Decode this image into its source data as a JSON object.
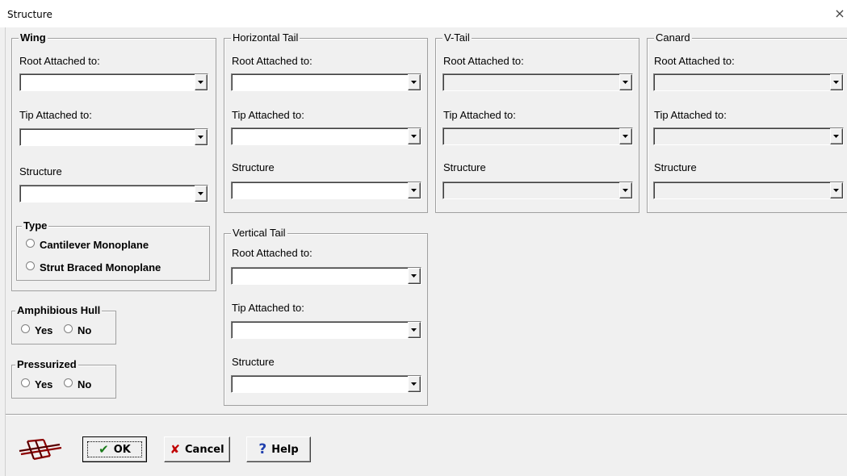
{
  "window": {
    "title": "Structure",
    "close_glyph": "×"
  },
  "wing": {
    "title": "Wing",
    "root_label": "Root Attached to:",
    "tip_label": "Tip Attached to:",
    "structure_label": "Structure",
    "root_value": "",
    "tip_value": "",
    "structure_value": "",
    "type": {
      "title": "Type",
      "options": [
        "Cantilever Monoplane",
        "Strut Braced Monoplane"
      ]
    }
  },
  "horizontal_tail": {
    "title": "Horizontal Tail",
    "root_label": "Root Attached to:",
    "tip_label": "Tip Attached to:",
    "structure_label": "Structure",
    "root_value": "",
    "tip_value": "",
    "structure_value": ""
  },
  "v_tail": {
    "title": "V-Tail",
    "root_label": "Root Attached to:",
    "tip_label": "Tip Attached to:",
    "structure_label": "Structure",
    "root_value": "",
    "tip_value": "",
    "structure_value": "",
    "enabled": false
  },
  "canard": {
    "title": "Canard",
    "root_label": "Root Attached to:",
    "tip_label": "Tip Attached to:",
    "structure_label": "Structure",
    "root_value": "",
    "tip_value": "",
    "structure_value": "",
    "enabled": false
  },
  "vertical_tail": {
    "title": "Vertical Tail",
    "root_label": "Root Attached to:",
    "tip_label": "Tip Attached to:",
    "structure_label": "Structure",
    "root_value": "",
    "tip_value": "",
    "structure_value": ""
  },
  "amphibious_hull": {
    "title": "Amphibious Hull",
    "yes": "Yes",
    "no": "No"
  },
  "pressurized": {
    "title": "Pressurized",
    "yes": "Yes",
    "no": "No"
  },
  "buttons": {
    "ok": "OK",
    "cancel": "Cancel",
    "help": "Help",
    "ok_icon": "checkmark-icon",
    "cancel_icon": "x-icon",
    "help_icon": "question-mark-icon"
  },
  "colors": {
    "ok_check": "#1a7a1a",
    "cancel_x": "#c00000",
    "help_q": "#1f3fae",
    "structure_icon": "#8b0000"
  }
}
